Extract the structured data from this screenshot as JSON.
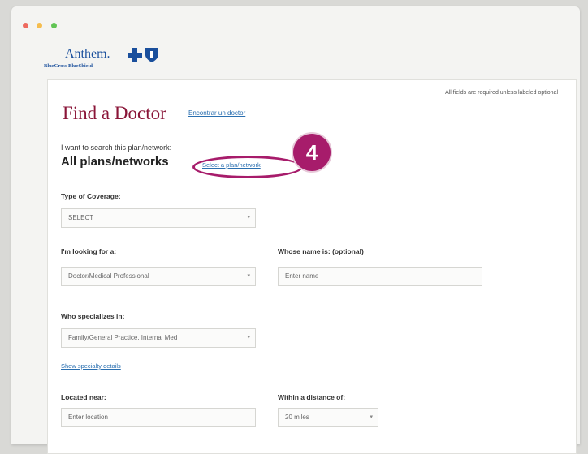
{
  "window": {
    "dots": [
      "#ee6a5f",
      "#f5bd4f",
      "#61c454"
    ]
  },
  "brand": {
    "name": "Anthem.",
    "sub": "BlueCross BlueShield",
    "color": "#1a4f9c"
  },
  "form": {
    "required_note": "All fields are required unless labeled optional",
    "title": "Find a Doctor",
    "espanol_link": "Encontrar un doctor",
    "plan_label": "I want to search this plan/network:",
    "plan_value": "All plans/networks",
    "plan_link": "Select a plan/network",
    "step_badge": "4",
    "coverage_label": "Type of Coverage:",
    "coverage_value": "SELECT",
    "looking_label": "I'm looking for a:",
    "looking_value": "Doctor/Medical Professional",
    "name_label": "Whose name is: (optional)",
    "name_placeholder": "Enter name",
    "specialty_label": "Who specializes in:",
    "specialty_value": "Family/General Practice, Internal Med",
    "specialty_link": "Show specialty details",
    "location_label": "Located near:",
    "location_placeholder": "Enter location",
    "distance_label": "Within a distance of:",
    "distance_value": "20 miles"
  },
  "colors": {
    "title": "#8a1538",
    "link": "#2a6fb0",
    "accent": "#a71c6b"
  }
}
